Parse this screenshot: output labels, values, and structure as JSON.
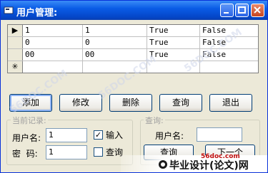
{
  "window": {
    "title": "用户管理:"
  },
  "grid": {
    "rows": [
      {
        "selector": "▶",
        "c1": "1",
        "c2": "1",
        "c3": "True",
        "c4": "False"
      },
      {
        "selector": "",
        "c1": "0",
        "c2": "0",
        "c3": "True",
        "c4": "False"
      },
      {
        "selector": "",
        "c1": "00",
        "c2": "00",
        "c3": "True",
        "c4": "False"
      },
      {
        "selector": "✳",
        "c1": "",
        "c2": "",
        "c3": "",
        "c4": ""
      }
    ]
  },
  "buttons": {
    "add": "添加",
    "edit": "修改",
    "delete": "删除",
    "query": "查询",
    "exit": "退出"
  },
  "current": {
    "legend": "当前记录:",
    "username_label": "用户名:",
    "username_value": "1",
    "password_label": "密  码:",
    "password_value": "1",
    "chk_input_label": "输入",
    "chk_input_checked": "✓",
    "chk_query_label": "查询"
  },
  "query": {
    "legend": "查询:",
    "username_label": "用户名:",
    "query_button": "查询",
    "next_button": "下一个"
  },
  "watermark": {
    "text": "56DOC.COM",
    "site": "56doc.com",
    "brand": "毕业设计(论文)网"
  }
}
